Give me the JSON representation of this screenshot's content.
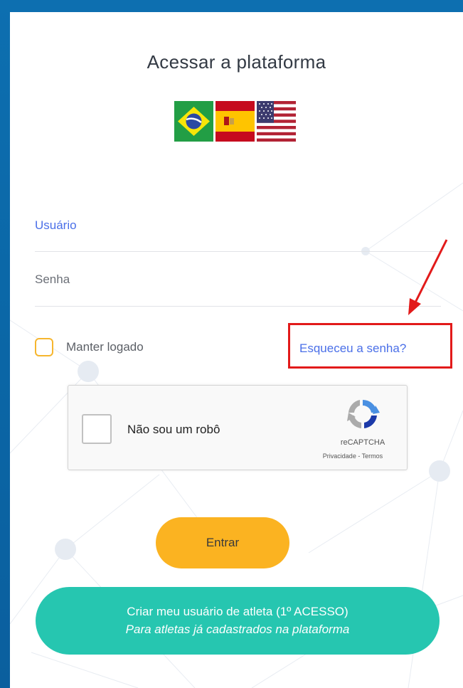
{
  "page": {
    "title": "Acessar a plataforma"
  },
  "languages": [
    {
      "name": "Português",
      "icon": "brazil-flag-icon"
    },
    {
      "name": "Español",
      "icon": "spain-flag-icon"
    },
    {
      "name": "English",
      "icon": "usa-flag-icon"
    }
  ],
  "form": {
    "username_label": "Usuário",
    "password_label": "Senha",
    "remember_label": "Manter logado",
    "forgot_link": "Esqueceu a senha?"
  },
  "recaptcha": {
    "label": "Não sou um robô",
    "brand": "reCAPTCHA",
    "privacy": "Privacidade",
    "separator": " - ",
    "terms": "Termos"
  },
  "buttons": {
    "login": "Entrar",
    "create_line1": "Criar meu usuário de atleta (1º ACESSO)",
    "create_line2": "Para atletas já cadastrados na plataforma"
  },
  "colors": {
    "background": "#0b68a8",
    "accent_link": "#4a6fe8",
    "login_button": "#fbb321",
    "create_button": "#26c6b0",
    "highlight": "#e21a1a",
    "checkbox_border": "#f6b62e"
  }
}
